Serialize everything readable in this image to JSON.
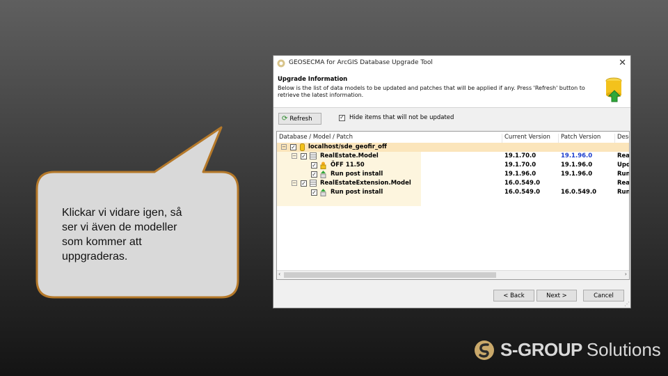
{
  "bubble": {
    "lines": [
      "Klickar vi vidare igen, så",
      "ser vi även de modeller",
      "som kommer att",
      "uppgraderas."
    ]
  },
  "window": {
    "title": "GEOSECMA for ArcGIS Database Upgrade Tool",
    "close_icon": "close-icon",
    "info": {
      "heading": "Upgrade Information",
      "description": "Below is the list of data models to be updated and patches that will be applied if any. Press 'Refresh' button to retrieve the latest information.",
      "icon": "database-upgrade-icon"
    },
    "toolbar": {
      "refresh_label": "Refresh",
      "hide_label": "Hide items that will not be updated",
      "hide_checked": true
    },
    "grid": {
      "columns": [
        "Database / Model / Patch",
        "Current Version",
        "Patch Version",
        "Desc"
      ],
      "rows": [
        {
          "name": "localhost/sde_geofir_off",
          "current": "",
          "patch": "",
          "desc": "",
          "level": 0,
          "icon": "database-icon"
        },
        {
          "name": "RealEstate.Model",
          "current": "19.1.70.0",
          "patch": "19.1.96.0",
          "desc": "Rea",
          "level": 1,
          "icon": "model-icon"
        },
        {
          "name": "ÖFF 11.50",
          "current": "19.1.70.0",
          "patch": "19.1.96.0",
          "desc": "Upd",
          "level": 2,
          "icon": "patch-icon"
        },
        {
          "name": "Run post install",
          "current": "19.1.96.0",
          "patch": "19.1.96.0",
          "desc": "Run",
          "level": 2,
          "icon": "install-icon"
        },
        {
          "name": "RealEstateExtension.Model",
          "current": "16.0.549.0",
          "patch": "",
          "desc": "Rea",
          "level": 1,
          "icon": "model-icon"
        },
        {
          "name": "Run post install",
          "current": "16.0.549.0",
          "patch": "16.0.549.0",
          "desc": "Run",
          "level": 2,
          "icon": "install-icon"
        }
      ]
    },
    "footer": {
      "back_label": "< Back",
      "next_label": "Next >",
      "cancel_label": "Cancel"
    }
  },
  "logo": {
    "brand_bold": "S-GROUP",
    "brand_light": "Solutions"
  },
  "colors": {
    "bubble_fill": "#d9d9d9",
    "bubble_stroke": "#b5792a",
    "selection": "#fbe5bb",
    "patch_version_blue": "#1a3ccc"
  }
}
